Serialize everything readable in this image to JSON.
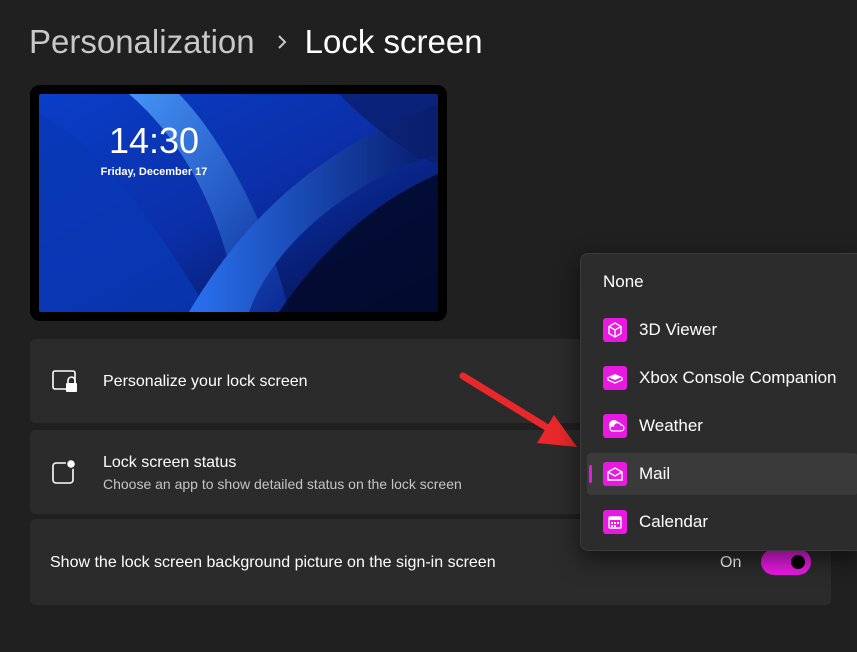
{
  "breadcrumb": {
    "parent": "Personalization",
    "separator_icon": "chevron-right-icon",
    "current": "Lock screen"
  },
  "preview": {
    "time": "14:30",
    "date": "Friday, December 17"
  },
  "settings": {
    "personalize": {
      "title": "Personalize your lock screen",
      "icon": "lock-screen-image-icon"
    },
    "status": {
      "title": "Lock screen status",
      "description": "Choose an app to show detailed status on the lock screen",
      "icon": "status-badge-icon"
    },
    "signin_background": {
      "title": "Show the lock screen background picture on the sign-in screen",
      "toggle_label": "On",
      "toggle_on": true
    }
  },
  "dropdown": {
    "items": [
      {
        "label": "None"
      },
      {
        "label": "3D Viewer",
        "icon": "cube-icon"
      },
      {
        "label": "Xbox Console Companion",
        "icon": "xbox-console-icon"
      },
      {
        "label": "Weather",
        "icon": "weather-icon"
      },
      {
        "label": "Mail",
        "icon": "mail-icon"
      },
      {
        "label": "Calendar",
        "icon": "calendar-icon"
      }
    ],
    "selected": "Mail"
  },
  "colors": {
    "accent": "#e81ae2",
    "arrow": "#e8282b",
    "background": "#202020",
    "card": "#2b2b2b"
  }
}
